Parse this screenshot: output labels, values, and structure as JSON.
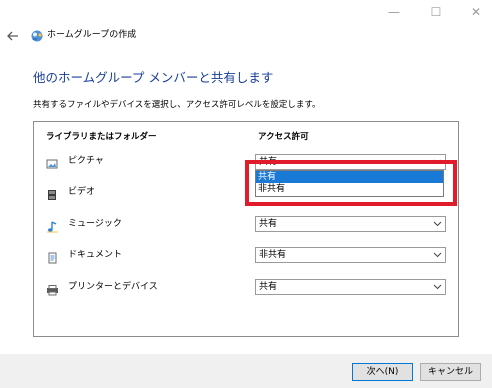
{
  "window": {
    "title": "ホームグループの作成",
    "controls": {
      "minimize": "—",
      "maximize": "☐",
      "close": "✕"
    }
  },
  "page": {
    "heading": "他のホームグループ メンバーと共有します",
    "description": "共有するファイルやデバイスを選択し、アクセス許可レベルを設定します。"
  },
  "table": {
    "headers": {
      "library": "ライブラリまたはフォルダー",
      "permission": "アクセス許可"
    },
    "rows": [
      {
        "label": "ピクチャ",
        "icon": "pictures-icon",
        "value": "共有"
      },
      {
        "label": "ビデオ",
        "icon": "videos-icon",
        "value": ""
      },
      {
        "label": "ミュージック",
        "icon": "music-icon",
        "value": "共有"
      },
      {
        "label": "ドキュメント",
        "icon": "documents-icon",
        "value": "非共有"
      },
      {
        "label": "プリンターとデバイス",
        "icon": "printer-icon",
        "value": "共有"
      }
    ]
  },
  "dropdown": {
    "options": [
      "共有",
      "非共有"
    ],
    "highlighted": "共有"
  },
  "colors": {
    "heading": "#1a3e9a",
    "highlight": "#e01c2a",
    "selected_option": "#1979d6"
  },
  "footer": {
    "next_label": "次へ(N)",
    "cancel_label": "キャンセル"
  }
}
